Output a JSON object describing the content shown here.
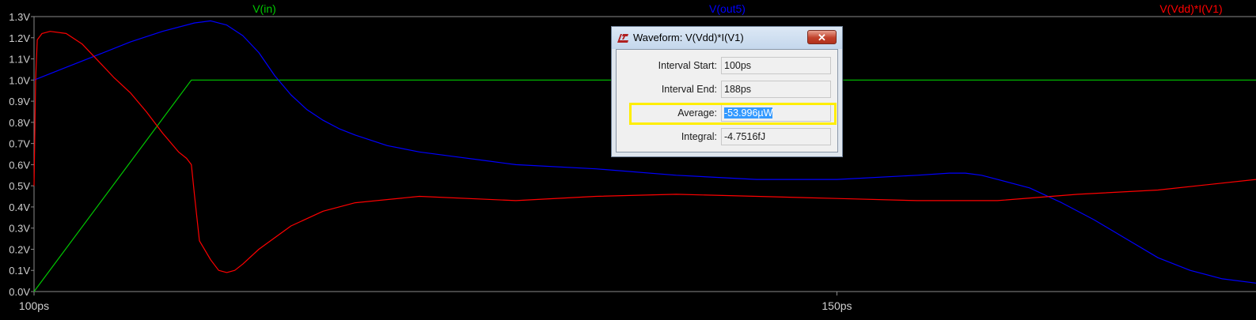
{
  "chart_data": {
    "type": "line",
    "title": "",
    "xlabel": "",
    "ylabel": "",
    "x_ticks": [
      {
        "value": 100,
        "label": "100ps"
      },
      {
        "value": 150,
        "label": "150ps"
      }
    ],
    "xlim": [
      100,
      176.1
    ],
    "y_ticks": [
      {
        "value": 0.0,
        "label": "0.0V"
      },
      {
        "value": 0.1,
        "label": "0.1V"
      },
      {
        "value": 0.2,
        "label": "0.2V"
      },
      {
        "value": 0.3,
        "label": "0.3V"
      },
      {
        "value": 0.4,
        "label": "0.4V"
      },
      {
        "value": 0.5,
        "label": "0.5V"
      },
      {
        "value": 0.6,
        "label": "0.6V"
      },
      {
        "value": 0.7,
        "label": "0.7V"
      },
      {
        "value": 0.8,
        "label": "0.8V"
      },
      {
        "value": 0.9,
        "label": "0.9V"
      },
      {
        "value": 1.0,
        "label": "1.0V"
      },
      {
        "value": 1.1,
        "label": "1.1V"
      },
      {
        "value": 1.2,
        "label": "1.2V"
      },
      {
        "value": 1.3,
        "label": "1.3V"
      }
    ],
    "ylim": [
      0,
      1.3
    ],
    "grid": false,
    "series": [
      {
        "name": "V(in)",
        "color": "#00c800",
        "x": [
          100,
          109.8,
          176.1
        ],
        "y": [
          0.0,
          1.0,
          1.0
        ]
      },
      {
        "name": "V(out5)",
        "color": "#0000ff",
        "x": [
          100,
          102,
          104,
          106,
          108,
          110,
          111,
          112,
          113,
          114,
          115,
          116,
          117,
          118,
          119,
          120,
          122,
          124,
          126,
          128,
          130,
          135,
          140,
          145,
          150,
          155,
          157,
          158,
          159,
          160,
          162,
          164,
          166,
          168,
          170,
          172,
          174,
          176.1
        ],
        "y": [
          1.0,
          1.06,
          1.12,
          1.18,
          1.23,
          1.27,
          1.28,
          1.26,
          1.21,
          1.13,
          1.02,
          0.93,
          0.86,
          0.81,
          0.77,
          0.74,
          0.69,
          0.66,
          0.64,
          0.62,
          0.6,
          0.58,
          0.55,
          0.53,
          0.53,
          0.55,
          0.56,
          0.56,
          0.55,
          0.53,
          0.49,
          0.42,
          0.34,
          0.25,
          0.16,
          0.1,
          0.06,
          0.04
        ]
      },
      {
        "name": "V(Vdd)*I(V1)",
        "color": "#ff0000",
        "x": [
          100,
          100.1,
          100.2,
          100.5,
          101,
          102,
          103,
          104,
          105,
          106,
          107,
          108,
          109,
          109.5,
          109.8,
          110,
          110.3,
          111,
          111.5,
          112,
          112.5,
          113,
          114,
          116,
          118,
          120,
          124,
          130,
          135,
          140,
          145,
          150,
          155,
          160,
          165,
          170,
          176.1
        ],
        "y": [
          0.5,
          1.0,
          1.19,
          1.22,
          1.23,
          1.22,
          1.17,
          1.09,
          1.01,
          0.94,
          0.85,
          0.75,
          0.66,
          0.63,
          0.6,
          0.45,
          0.24,
          0.15,
          0.1,
          0.09,
          0.1,
          0.13,
          0.2,
          0.31,
          0.38,
          0.42,
          0.45,
          0.43,
          0.45,
          0.46,
          0.45,
          0.44,
          0.43,
          0.43,
          0.46,
          0.48,
          0.53
        ]
      }
    ]
  },
  "dialog": {
    "title": "Waveform: V(Vdd)*I(V1)",
    "close_label": "✕",
    "interval_start_label": "Interval Start:",
    "interval_start_value": "100ps",
    "interval_end_label": "Interval End:",
    "interval_end_value": "188ps",
    "average_label": "Average:",
    "average_value": "-53.996µW",
    "integral_label": "Integral:",
    "integral_value": "-4.7516fJ",
    "highlight_color": "#ffee00"
  }
}
